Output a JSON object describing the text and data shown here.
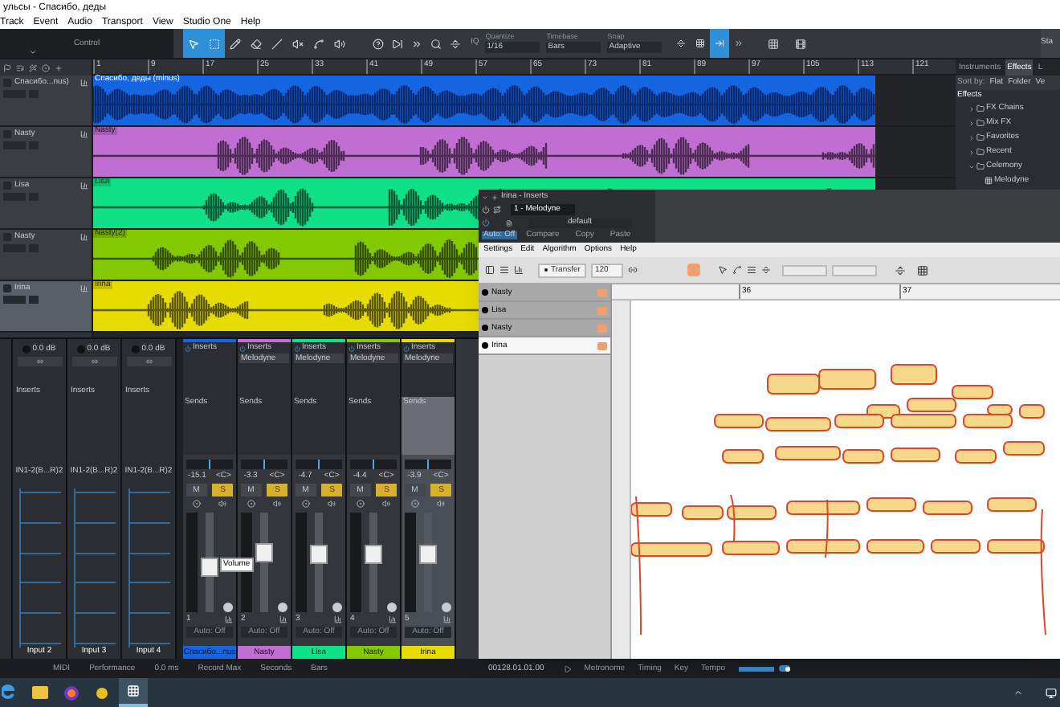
{
  "window": {
    "title": "ульсы - Спасибо, деды"
  },
  "menu": [
    "Track",
    "Event",
    "Audio",
    "Transport",
    "View",
    "Studio One",
    "Help"
  ],
  "toolbar": {
    "control": "Control",
    "tools": [
      {
        "kind": "arrow",
        "selected": true
      },
      {
        "kind": "range",
        "selected": true
      },
      {
        "kind": "pencil",
        "selected": false
      },
      {
        "kind": "eraser",
        "selected": false
      },
      {
        "kind": "line",
        "selected": false
      },
      {
        "kind": "mute",
        "selected": false
      },
      {
        "kind": "bend",
        "selected": false
      },
      {
        "kind": "listen",
        "selected": false
      }
    ],
    "quantize": {
      "label": "Quantize",
      "value": "1/16"
    },
    "timebase": {
      "label": "Timebase",
      "value": "Bars"
    },
    "snap": {
      "label": "Snap",
      "value": "Adaptive"
    },
    "iq": "IQ",
    "snap_tools": [
      {
        "kind": "spacing",
        "selected": false
      },
      {
        "kind": "zero",
        "selected": false
      },
      {
        "kind": "snap",
        "selected": true
      },
      {
        "kind": "cursor",
        "selected": false
      }
    ],
    "start": "Sta"
  },
  "ruler": [
    "1",
    "9",
    "17",
    "25",
    "33",
    "41",
    "49",
    "57",
    "65",
    "73",
    "81",
    "89",
    "97",
    "105",
    "113",
    "121"
  ],
  "tracks": [
    {
      "name": "Спасибо...nus)",
      "clip": "Спасибо, деды (minus)",
      "color": "#1565e0",
      "selected": false
    },
    {
      "name": "Nasty",
      "clip": "Nasty",
      "color": "#c06ed2",
      "selected": false
    },
    {
      "name": "Lisa",
      "clip": "Lisa",
      "color": "#10e088",
      "selected": false
    },
    {
      "name": "Nasty",
      "clip": "Nasty(2)",
      "color": "#84c800",
      "selected": false
    },
    {
      "name": "Irina",
      "clip": "Irina",
      "color": "#e6dc00",
      "selected": true
    }
  ],
  "browser": {
    "tabs": [
      {
        "label": "Instruments",
        "selected": false
      },
      {
        "label": "Effects",
        "selected": true
      },
      {
        "label": "L",
        "selected": false
      }
    ],
    "sort_label": "Sort by:",
    "sort_options": [
      "Flat",
      "Folder",
      "Ve"
    ],
    "section": "Effects",
    "tree": [
      {
        "label": "FX Chains"
      },
      {
        "label": "Mix FX"
      },
      {
        "label": "Favorites"
      },
      {
        "label": "Recent"
      },
      {
        "label": "Celemony",
        "children": [
          {
            "label": "Melodyne"
          }
        ]
      }
    ]
  },
  "mixer": {
    "inputs": [
      {
        "gain": "0.0 dB",
        "inserts": "Inserts",
        "source": "IN1-2(B...R)2",
        "name": "Input 2"
      },
      {
        "gain": "0.0 dB",
        "inserts": "Inserts",
        "source": "IN1-2(B...R)2",
        "name": "Input 3"
      },
      {
        "gain": "0.0 dB",
        "inserts": "Inserts",
        "source": "IN1-2(B...R)2",
        "name": "Input 4"
      }
    ],
    "channels": [
      {
        "number": "1",
        "name": "Спасибо...nus",
        "color": "#1565e0",
        "inserts_label": "Inserts",
        "sends": "Sends",
        "volume": "-15.1",
        "pan": "<C>",
        "mute": "M",
        "solo": "S",
        "solo_on": true,
        "level": 0.45,
        "auto": "Auto: Off",
        "selected": false
      },
      {
        "number": "2",
        "name": "Nasty",
        "color": "#c06ed2",
        "inserts_label": "Inserts",
        "inserts": [
          "Melodyne"
        ],
        "sends": "Sends",
        "volume": "-3.3",
        "pan": "<C>",
        "mute": "M",
        "solo": "S",
        "solo_on": true,
        "level": 0.62,
        "auto": "Auto: Off",
        "selected": false
      },
      {
        "number": "3",
        "name": "Lisa",
        "color": "#10e088",
        "inserts_label": "Inserts",
        "inserts": [
          "Melodyne"
        ],
        "sends": "Sends",
        "volume": "-4.7",
        "pan": "<C>",
        "mute": "M",
        "solo": "S",
        "solo_on": true,
        "level": 0.6,
        "auto": "Auto: Off",
        "selected": false
      },
      {
        "number": "4",
        "name": "Nasty",
        "color": "#84c800",
        "inserts_label": "Inserts",
        "inserts": [
          "Melodyne"
        ],
        "sends": "Sends",
        "volume": "-4.4",
        "pan": "<C>",
        "mute": "M",
        "solo": "S",
        "solo_on": true,
        "level": 0.6,
        "auto": "Auto: Off",
        "selected": false
      },
      {
        "number": "5",
        "name": "Irina",
        "color": "#e6dc00",
        "inserts_label": "Inserts",
        "inserts": [
          "Melodyne"
        ],
        "sends": "Sends",
        "volume": "-3.9",
        "pan": "<C>",
        "mute": "M",
        "solo": "S",
        "solo_on": true,
        "level": 0.6,
        "auto": "Auto: Off",
        "selected": true
      }
    ],
    "tooltip": "Volume"
  },
  "melodyne": {
    "title": "Irina - Inserts",
    "preset": "1 - Melodyne",
    "file": "default",
    "auto": "Auto: Off",
    "actions": [
      "Compare",
      "Copy",
      "Paste"
    ],
    "menu": [
      "Settings",
      "Edit",
      "Algorithm",
      "Options",
      "Help"
    ],
    "transfer": "Transfer",
    "tempo": "120",
    "tracks": [
      {
        "name": "Nasty",
        "selected": false
      },
      {
        "name": "Lisa",
        "selected": false
      },
      {
        "name": "Nasty",
        "selected": false
      },
      {
        "name": "Irina",
        "selected": true
      }
    ],
    "ruler": [
      "36",
      "37"
    ]
  },
  "status_bar": {
    "left": [
      "MIDI",
      "Performance",
      "0.0 ms",
      "Record Max",
      "Seconds",
      "Bars"
    ],
    "time": "00128.01.01.00",
    "right": [
      "Metronome",
      "Timing",
      "Key",
      "Tempo"
    ],
    "toggle_on": true
  }
}
